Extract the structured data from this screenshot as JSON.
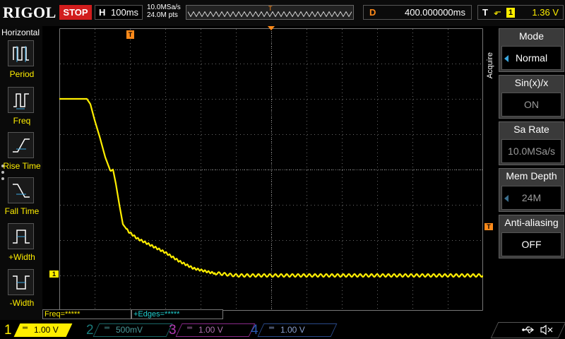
{
  "topbar": {
    "brand": "RIGOL",
    "run_state": "STOP",
    "horizontal_letter": "H",
    "timebase": "100ms",
    "sample_rate": "10.0MSa/s",
    "memory_points": "24.0M pts",
    "trigger_marker": "T",
    "delay_letter": "D",
    "delay": "400.000000ms",
    "trigger_letter": "T",
    "trigger_edge_glyph": "⬐",
    "trigger_source": "1",
    "trigger_level": "1.36 V"
  },
  "left_panel": {
    "title": "Horizontal",
    "items": [
      {
        "label": "Period"
      },
      {
        "label": "Freq"
      },
      {
        "label": "Rise Time"
      },
      {
        "label": "Fall Time"
      },
      {
        "label": "+Width"
      },
      {
        "label": "-Width"
      }
    ]
  },
  "graticule": {
    "ch1_marker": "1",
    "trigger_position_marker": "T",
    "trigger_level_marker": "T"
  },
  "right_menu": {
    "title": "Acquire",
    "items": [
      {
        "label": "Mode",
        "value": "Normal"
      },
      {
        "label": "Sin(x)/x",
        "value": "ON"
      },
      {
        "label": "Sa Rate",
        "value": "10.0MSa/s"
      },
      {
        "label": "Mem Depth",
        "value": "24M"
      },
      {
        "label": "Anti-aliasing",
        "value": "OFF"
      }
    ]
  },
  "measurements": {
    "freq": "Freq=*****",
    "edges": "+Edges=*****"
  },
  "channels": [
    {
      "number": "1",
      "coupling": "═",
      "scale": "1.00 V"
    },
    {
      "number": "2",
      "coupling": "═",
      "scale": "500mV"
    },
    {
      "number": "3",
      "coupling": "═",
      "scale": "1.00 V"
    },
    {
      "number": "4",
      "coupling": "═",
      "scale": "1.00 V"
    }
  ],
  "colors": {
    "ch1": "#ffee00",
    "ch2": "#1a7a7a",
    "ch3": "#b43bb4",
    "ch4": "#2a5ab4",
    "trigger": "#ff8a1a",
    "stop": "#d11d1d",
    "menu_arrow": "#3aa7e0"
  },
  "icons": [
    "usb-icon",
    "speaker-mute-icon"
  ],
  "waveform": {
    "channel": "1",
    "high_level_divs": 6.0,
    "low_level_divs": 1.0,
    "points_divs": [
      [
        0.0,
        6.0
      ],
      [
        0.78,
        6.0
      ],
      [
        0.88,
        5.85
      ],
      [
        1.0,
        5.4
      ],
      [
        1.15,
        4.9
      ],
      [
        1.3,
        4.35
      ],
      [
        1.45,
        3.95
      ],
      [
        1.52,
        4.0
      ],
      [
        1.6,
        3.6
      ],
      [
        1.7,
        3.0
      ],
      [
        1.8,
        2.45
      ],
      [
        1.95,
        2.25
      ],
      [
        2.2,
        2.05
      ],
      [
        2.6,
        1.85
      ],
      [
        3.0,
        1.65
      ],
      [
        3.4,
        1.4
      ],
      [
        3.8,
        1.2
      ],
      [
        4.3,
        1.08
      ],
      [
        5.0,
        1.0
      ],
      [
        12.0,
        1.0
      ]
    ],
    "ripple_divs": 0.04
  }
}
